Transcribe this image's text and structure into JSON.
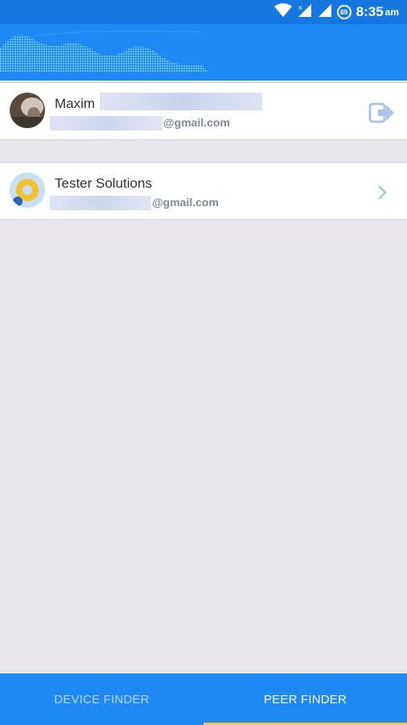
{
  "status_bar": {
    "battery": "89",
    "time": "8:35",
    "ampm": "am",
    "icons": [
      "wifi-icon",
      "signal-x-icon",
      "signal-icon",
      "battery-icon"
    ]
  },
  "accounts": [
    {
      "name": "Maxim",
      "email_domain": "@gmail.com",
      "trailing_icon": "logout-icon"
    },
    {
      "name": "Tester Solutions",
      "email_domain": "@gmail.com",
      "trailing_icon": "chevron-right-icon"
    }
  ],
  "bottom_nav": {
    "tabs": [
      {
        "label": "DEVICE FINDER",
        "active": false
      },
      {
        "label": "PEER FINDER",
        "active": true
      }
    ]
  },
  "colors": {
    "primary": "#1e88f5",
    "status_bar": "#1478e0",
    "background": "#e9e6ec",
    "tab_indicator": "#f5c542"
  }
}
